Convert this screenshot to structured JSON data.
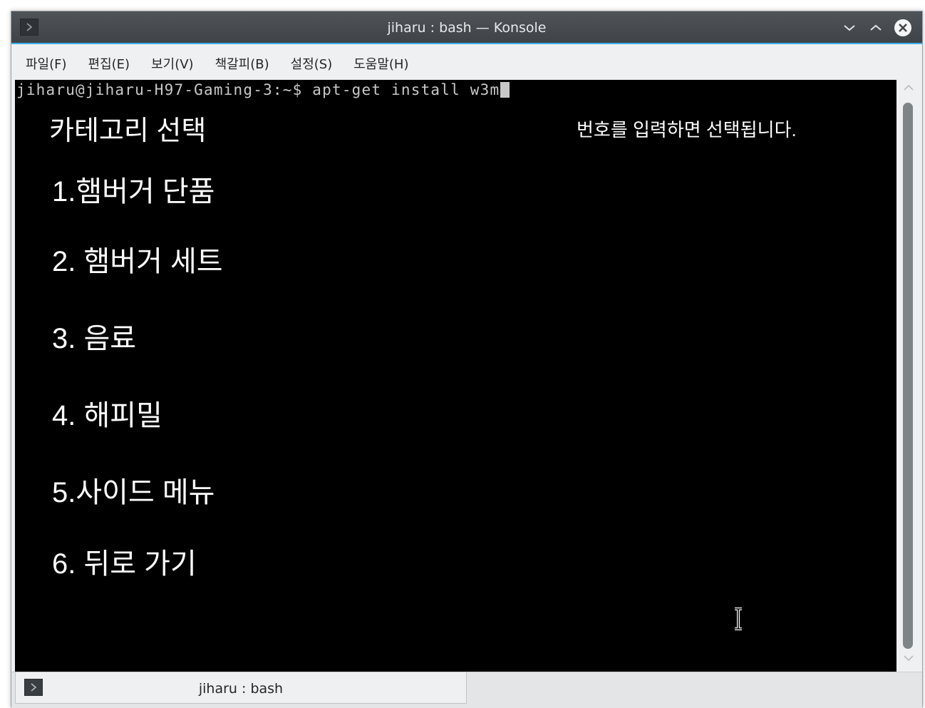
{
  "window": {
    "title": "jiharu : bash — Konsole"
  },
  "menubar": {
    "items": [
      "파일(F)",
      "편집(E)",
      "보기(V)",
      "책갈피(B)",
      "설정(S)",
      "도움말(H)"
    ]
  },
  "terminal": {
    "prompt": "jiharu@jiharu-H97-Gaming-3:~$ apt-get install w3m",
    "heading": "카테고리 선택",
    "hint": "번호를 입력하면 선택됩니다.",
    "items": [
      "1.햄버거 단품",
      "2. 햄버거 세트",
      "3. 음료",
      "4. 해피밀",
      "5.사이드 메뉴",
      "6. 뒤로 가기"
    ]
  },
  "tabbar": {
    "tabs": [
      {
        "label": "jiharu : bash"
      }
    ]
  },
  "icons": {
    "app": "terminal-icon",
    "minimize": "chevron-down-icon",
    "maximize": "chevron-up-icon",
    "close": "close-icon",
    "tab": "terminal-icon",
    "cursor": "text-cursor-icon"
  },
  "colors": {
    "accent": "#3daee9",
    "terminal_bg": "#000000",
    "terminal_fg": "#ffffff"
  }
}
